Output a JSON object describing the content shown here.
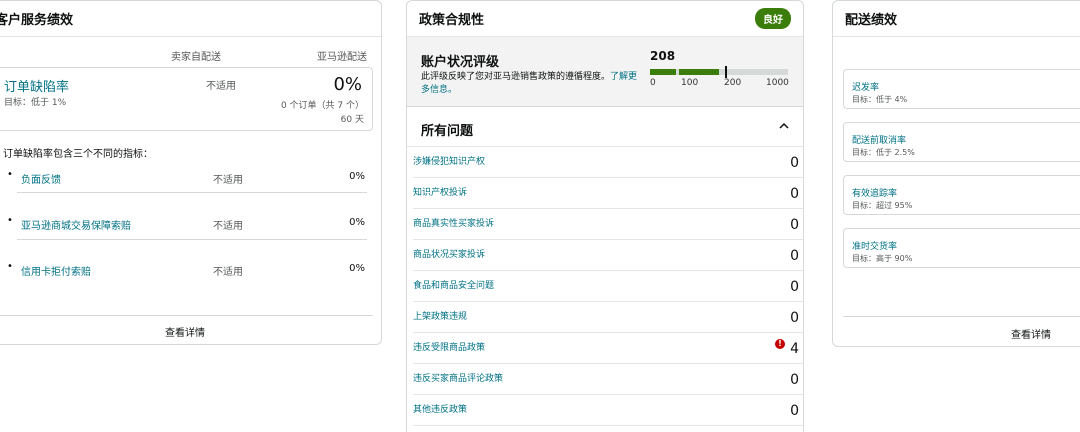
{
  "customer_service": {
    "title": "客户服务绩效",
    "col_seller": "卖家自配送",
    "col_amazon": "亚马逊配送",
    "odr": {
      "title": "订单缺陷率",
      "target": "目标：低于 1%",
      "seller_value": "不适用",
      "amazon_value": "0%",
      "orders": "0 个订单（共 7 个）",
      "days": "60 天"
    },
    "intro": "订单缺陷率包含三个不同的指标：",
    "metrics": [
      {
        "label": "负面反馈",
        "seller": "不适用",
        "amazon": "0%"
      },
      {
        "label": "亚马逊商城交易保障索赔",
        "seller": "不适用",
        "amazon": "0%"
      },
      {
        "label": "信用卡拒付索赔",
        "seller": "不适用",
        "amazon": "0%"
      }
    ],
    "details_link": "查看详情"
  },
  "policy": {
    "title": "政策合规性",
    "badge": "良好",
    "health": {
      "title": "账户状况评级",
      "description": "此评级反映了您对亚马逊销售政策的遵循程度。",
      "learn_more": "了解更多信息。",
      "score": "208",
      "score_value": 208,
      "scale_max": 1000,
      "ticks": [
        "0",
        "100",
        "200",
        "1000"
      ]
    },
    "issues_title": "所有问题",
    "issues": [
      {
        "label": "涉嫌侵犯知识产权",
        "count": "0"
      },
      {
        "label": "知识产权投诉",
        "count": "0"
      },
      {
        "label": "商品真实性买家投诉",
        "count": "0"
      },
      {
        "label": "商品状况买家投诉",
        "count": "0"
      },
      {
        "label": "食品和商品安全问题",
        "count": "0"
      },
      {
        "label": "上架政策违规",
        "count": "0"
      },
      {
        "label": "违反受限商品政策",
        "count": "4",
        "alert": true
      },
      {
        "label": "违反买家商品评论政策",
        "count": "0"
      },
      {
        "label": "其他违反政策",
        "count": "0"
      }
    ],
    "colors": {
      "good": "#3a7d0a",
      "alert": "#c40000",
      "link": "#007185"
    }
  },
  "shipping": {
    "title": "配送绩效",
    "metrics": [
      {
        "label": "迟发率",
        "target": "目标：低于 4%"
      },
      {
        "label": "配送前取消率",
        "target": "目标：低于 2.5%"
      },
      {
        "label": "有效追踪率",
        "target": "目标：超过 95%"
      },
      {
        "label": "准时交货率",
        "target": "目标：高于 90%"
      }
    ],
    "details_link": "查看详情"
  }
}
